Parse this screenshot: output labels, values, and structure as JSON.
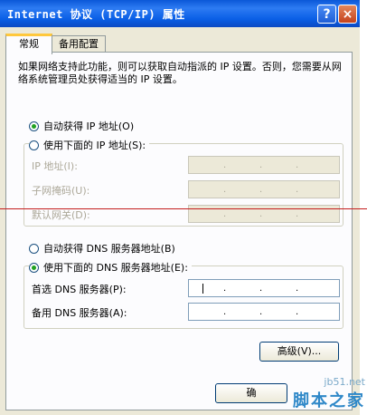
{
  "window": {
    "title": "Internet 协议 (TCP/IP) 属性",
    "help_label": "?",
    "close_label": "×"
  },
  "tabs": [
    {
      "label": "常规",
      "active": true
    },
    {
      "label": "备用配置",
      "active": false
    }
  ],
  "description": "如果网络支持此功能，则可以获取自动指派的 IP 设置。否则，您需要从网络系统管理员处获得适当的 IP 设置。",
  "ip_section": {
    "auto_label": "自动获得 IP 地址(O)",
    "manual_label": "使用下面的 IP 地址(S):",
    "auto_selected": true,
    "fields": [
      {
        "label": "IP 地址(I):",
        "value": ". . ."
      },
      {
        "label": "子网掩码(U):",
        "value": ". . ."
      },
      {
        "label": "默认网关(D):",
        "value": ". . ."
      }
    ]
  },
  "dns_section": {
    "auto_label": "自动获得 DNS 服务器地址(B)",
    "manual_label": "使用下面的 DNS 服务器地址(E):",
    "manual_selected": true,
    "fields": [
      {
        "label": "首选 DNS 服务器(P):",
        "value": ". . ."
      },
      {
        "label": "备用 DNS 服务器(A):",
        "value": ". . ."
      }
    ]
  },
  "buttons": {
    "advanced": "高级(V)...",
    "ok": "确"
  },
  "watermark": {
    "url": "jb51.net",
    "name": "脚本之家"
  }
}
